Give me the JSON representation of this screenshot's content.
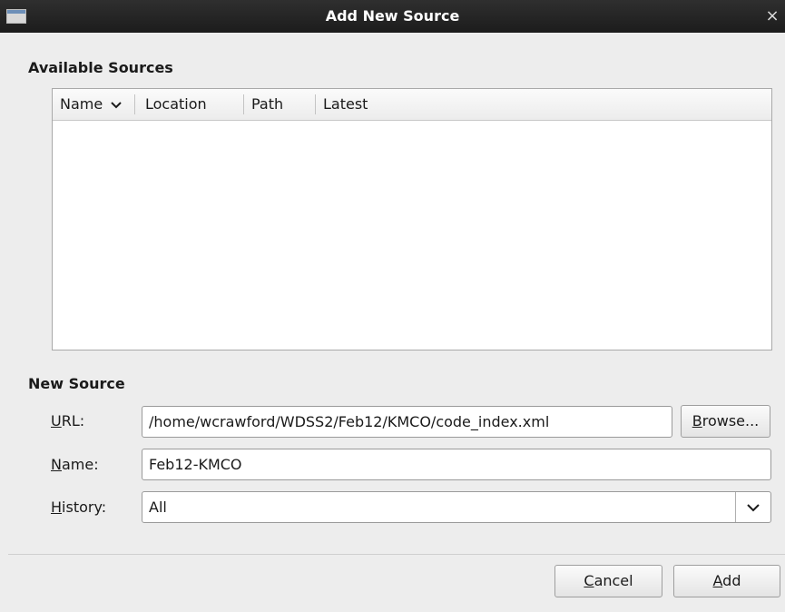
{
  "window": {
    "title": "Add New Source",
    "close_glyph": "×",
    "icon": "window-icon"
  },
  "available_sources": {
    "title": "Available Sources",
    "columns": [
      {
        "label": "Name",
        "sorted": true,
        "sort_icon": "chevron-down-icon"
      },
      {
        "label": "Location"
      },
      {
        "label": "Path"
      },
      {
        "label": "Latest"
      }
    ],
    "rows": []
  },
  "new_source": {
    "title": "New Source",
    "url": {
      "mnemonic": "U",
      "rest": "RL:",
      "value": "/home/wcrawford/WDSS2/Feb12/KMCO/code_index.xml"
    },
    "browse": {
      "mnemonic": "B",
      "rest": "rowse..."
    },
    "name": {
      "mnemonic": "N",
      "rest": "ame:",
      "value": "Feb12-KMCO"
    },
    "history": {
      "mnemonic": "H",
      "rest": "istory:",
      "value": "All",
      "arrow_icon": "chevron-down-icon"
    }
  },
  "buttons": {
    "cancel": {
      "mnemonic": "C",
      "rest": "ancel"
    },
    "add": {
      "mnemonic": "A",
      "rest": "dd"
    }
  }
}
